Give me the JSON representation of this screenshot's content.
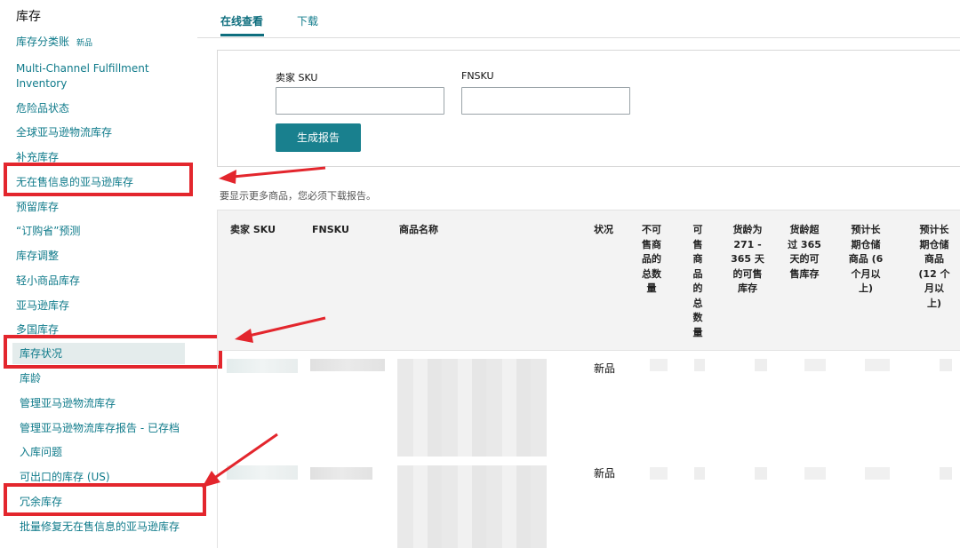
{
  "sidebar": {
    "title": "库存",
    "new_badge": "新品",
    "items": [
      "库存分类账",
      "Multi-Channel Fulfillment",
      "Inventory",
      "危险品状态",
      "全球亚马逊物流库存",
      "补充库存",
      "无在售信息的亚马逊库存",
      "预留库存",
      "“订购省”预测",
      "库存调整",
      "轻小商品库存",
      "亚马逊库存",
      "多国库存",
      "库存状况",
      "库龄",
      "管理亚马逊物流库存",
      "管理亚马逊物流库存报告 - 已存档",
      "入库问题",
      "可出口的库存 (US)",
      "冗余库存",
      "批量修复无在售信息的亚马逊库存"
    ]
  },
  "tabs": [
    "在线查看",
    "下载"
  ],
  "filter": {
    "seller_sku_label": "卖家 SKU",
    "fnsku_label": "FNSKU",
    "seller_sku_value": "",
    "fnsku_value": "",
    "generate_button": "生成报告"
  },
  "note": "要显示更多商品，您必须下载报告。",
  "table": {
    "headers": {
      "sku": "卖家 SKU",
      "fnsku": "FNSKU",
      "name": "商品名称",
      "status": "状况",
      "unsellable": [
        "不可",
        "售商",
        "品的",
        "总数",
        "量"
      ],
      "sellable": [
        "可",
        "售",
        "商",
        "品",
        "的",
        "总",
        "数",
        "量"
      ],
      "age_271_365": [
        "货龄为",
        "271 -",
        "365 天",
        "的可售",
        "库存"
      ],
      "age_over_365": [
        "货龄超",
        "过 365",
        "天的可",
        "售库存"
      ],
      "ltsf_6mo": [
        "预计长",
        "期仓储",
        "商品 (6",
        "个月以",
        "上)"
      ],
      "ltsf_12mo": [
        "预计长",
        "期仓储",
        "商品",
        "(12 个",
        "月以",
        "上)"
      ]
    },
    "rows": [
      {
        "status": "新品"
      },
      {
        "status": "新品"
      }
    ]
  },
  "colors": {
    "link": "#0e7a8a",
    "button": "#19808e",
    "annotation_red": "#e3262d",
    "header_bg": "#f3f3f3"
  }
}
